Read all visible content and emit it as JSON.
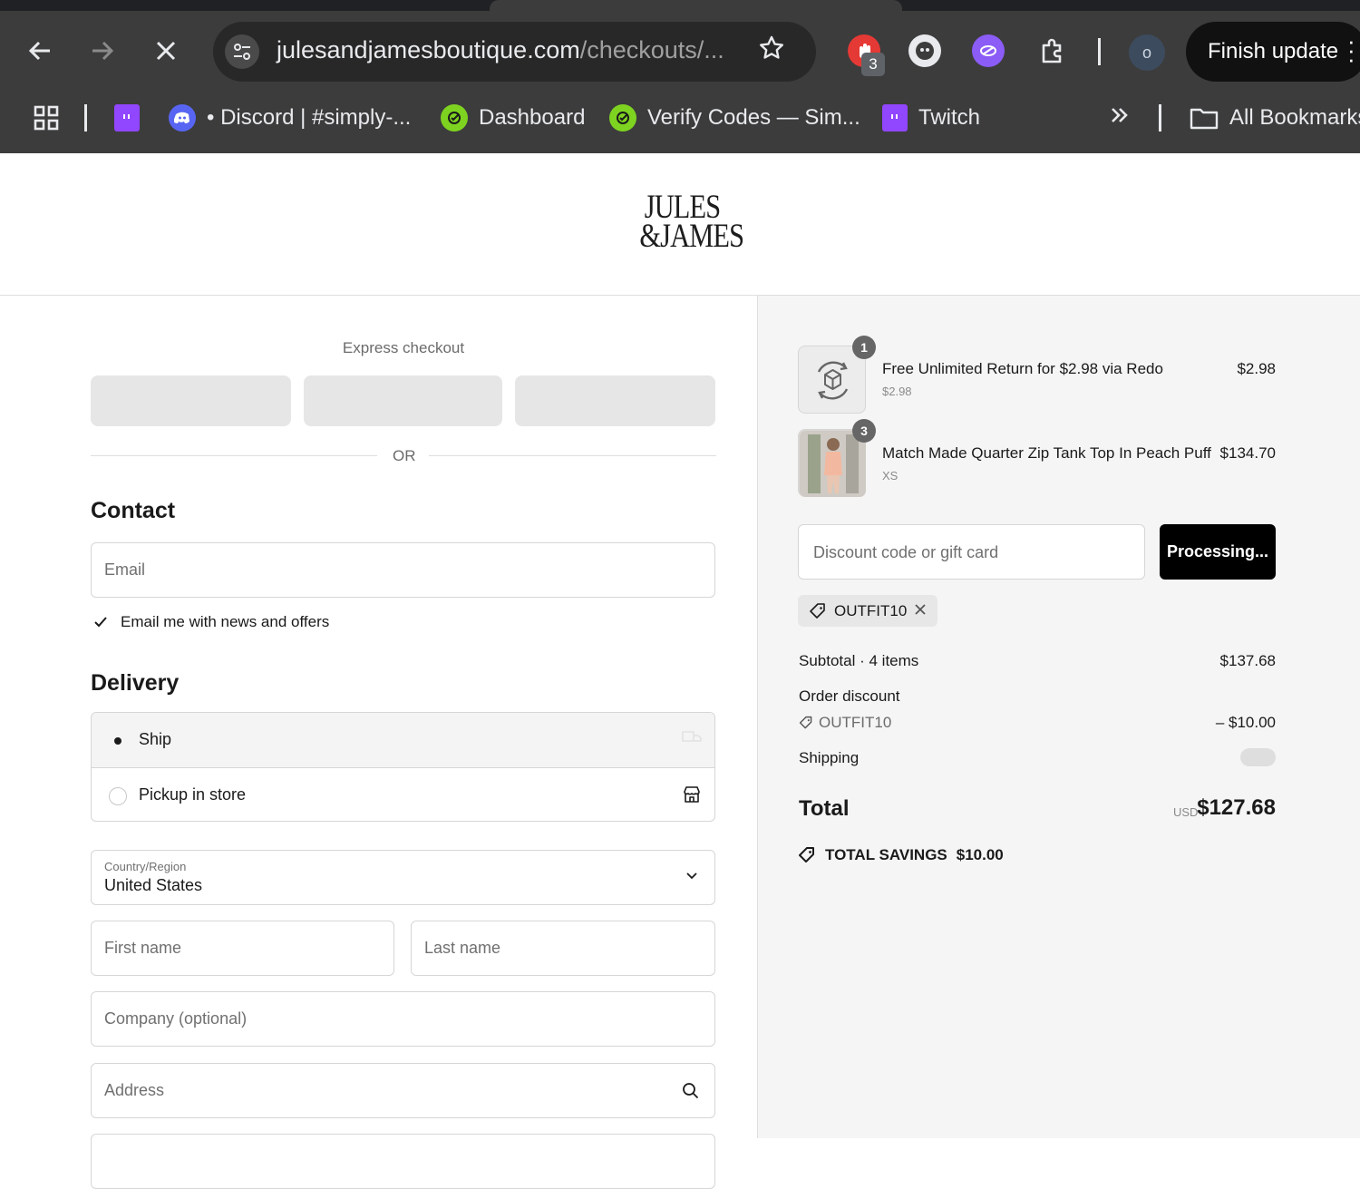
{
  "browser": {
    "url_host": "julesandjamesboutique.com",
    "url_path": "/checkouts/...",
    "extension_badge": "3",
    "profile_initial": "o",
    "finish_update": "Finish update",
    "bookmarks": [
      {
        "label": "",
        "icon": "twitch-icon"
      },
      {
        "label": "• Discord | #simply-...",
        "icon": "discord-icon"
      },
      {
        "label": "Dashboard",
        "icon": "verify-icon"
      },
      {
        "label": "Verify Codes — Sim...",
        "icon": "verify-icon"
      },
      {
        "label": "Twitch",
        "icon": "twitch-icon"
      }
    ],
    "all_bookmarks": "All Bookmarks"
  },
  "store": {
    "logo_line1": "JULES",
    "logo_line2": "&JAMES"
  },
  "checkout": {
    "express_title": "Express checkout",
    "or": "OR",
    "contact_title": "Contact",
    "email_placeholder": "Email",
    "email_opt_in": "Email me with news and offers",
    "delivery_title": "Delivery",
    "ship_label": "Ship",
    "pickup_label": "Pickup in store",
    "country_label": "Country/Region",
    "country_value": "United States",
    "first_name_placeholder": "First name",
    "last_name_placeholder": "Last name",
    "company_placeholder": "Company (optional)",
    "address_placeholder": "Address"
  },
  "summary": {
    "items": [
      {
        "name": "Free Unlimited Return for $2.98 via Redo",
        "sub": "$2.98",
        "price": "$2.98",
        "qty": "1"
      },
      {
        "name": "Match Made Quarter Zip Tank Top In Peach Puff",
        "sub": "XS",
        "price": "$134.70",
        "qty": "3"
      }
    ],
    "discount_placeholder": "Discount code or gift card",
    "apply_button": "Processing...",
    "applied_code": "OUTFIT10",
    "subtotal_label": "Subtotal · 4 items",
    "subtotal_value": "$137.68",
    "order_discount_label": "Order discount",
    "discount_code": "OUTFIT10",
    "discount_value": "– $10.00",
    "shipping_label": "Shipping",
    "total_label": "Total",
    "currency": "USD",
    "total_value": "$127.68",
    "savings_label": "TOTAL SAVINGS",
    "savings_value": "$10.00"
  }
}
